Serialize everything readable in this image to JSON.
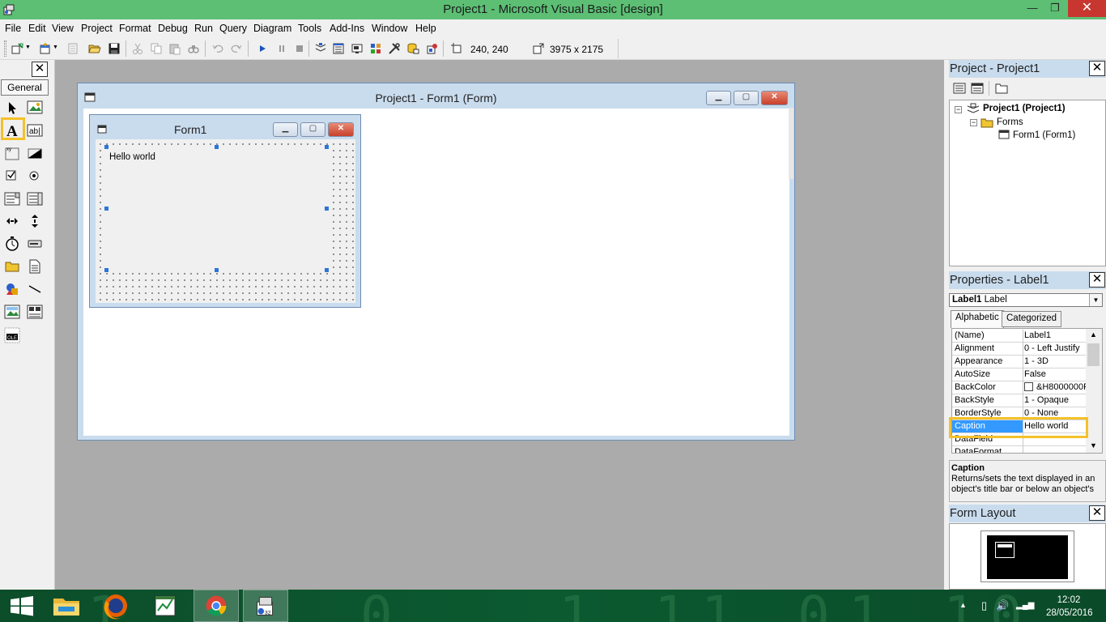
{
  "window": {
    "title": "Project1 - Microsoft Visual Basic [design]",
    "minimize": "—",
    "maximize": "❐",
    "close": "✕"
  },
  "menu": [
    "File",
    "Edit",
    "View",
    "Project",
    "Format",
    "Debug",
    "Run",
    "Query",
    "Diagram",
    "Tools",
    "Add-Ins",
    "Window",
    "Help"
  ],
  "toolbar": {
    "position": "240, 240",
    "size": "3975 x 2175"
  },
  "toolbox": {
    "close": "✕",
    "tab_label": "General",
    "selected_tool": "label-tool"
  },
  "form_window": {
    "title": "Project1 - Form1 (Form)",
    "min": "▁",
    "max": "▢",
    "close": "✕"
  },
  "inner_form": {
    "title": "Form1",
    "min": "▁",
    "max": "▢",
    "close": "✕",
    "label_caption": "Hello world"
  },
  "project_panel": {
    "title": "Project - Project1",
    "close": "✕",
    "tree": {
      "project": "Project1 (Project1)",
      "folder": "Forms",
      "form": "Form1 (Form1)"
    }
  },
  "properties_panel": {
    "title": "Properties - Label1",
    "close": "✕",
    "object_name": "Label1",
    "object_type": "Label",
    "tabs": [
      "Alphabetic",
      "Categorized"
    ],
    "rows": [
      {
        "name": "(Name)",
        "value": "Label1"
      },
      {
        "name": "Alignment",
        "value": "0 - Left Justify"
      },
      {
        "name": "Appearance",
        "value": "1 - 3D"
      },
      {
        "name": "AutoSize",
        "value": "False"
      },
      {
        "name": "BackColor",
        "value": "&H8000000F"
      },
      {
        "name": "BackStyle",
        "value": "1 - Opaque"
      },
      {
        "name": "BorderStyle",
        "value": "0 - None"
      },
      {
        "name": "Caption",
        "value": "Hello world"
      },
      {
        "name": "DataField",
        "value": ""
      },
      {
        "name": "DataFormat",
        "value": ""
      }
    ],
    "selected_row": "Caption",
    "description_title": "Caption",
    "description_text": "Returns/sets the text displayed in an object's title bar or below an object's"
  },
  "form_layout_panel": {
    "title": "Form Layout",
    "close": "✕"
  },
  "taskbar": {
    "time": "12:02",
    "date": "28/05/2016",
    "wallpaper_digits": [
      "1",
      "0",
      "1",
      "1",
      "1",
      "0",
      "1",
      "1",
      "0"
    ]
  },
  "colors": {
    "titlebar": "#5cbf74",
    "close_button": "#c7372f",
    "selection": "#3399ff",
    "highlight_box": "#f3c12a",
    "mdi_background": "#ababab"
  }
}
